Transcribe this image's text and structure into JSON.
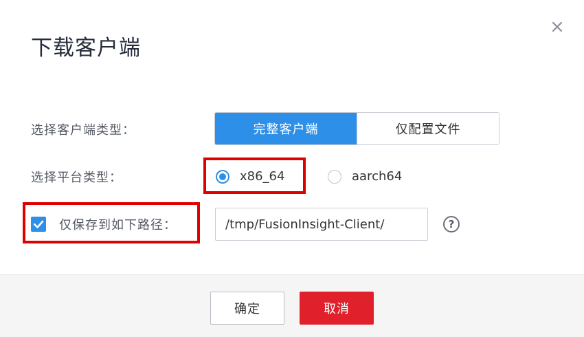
{
  "dialog": {
    "title": "下载客户端",
    "close_icon": "close-icon"
  },
  "client_type": {
    "label": "选择客户端类型：",
    "options": [
      "完整客户端",
      "仅配置文件"
    ],
    "selected": "完整客户端"
  },
  "platform": {
    "label": "选择平台类型：",
    "options": [
      "x86_64",
      "aarch64"
    ],
    "selected": "x86_64"
  },
  "save_path": {
    "checkbox_label": "仅保存到如下路径：",
    "checked": true,
    "value": "/tmp/FusionInsight-Client/",
    "help_icon": "help-circle-icon",
    "help_glyph": "?"
  },
  "footer": {
    "ok_label": "确定",
    "cancel_label": "取消"
  },
  "colors": {
    "accent": "#2d8fe8",
    "danger": "#e0202a",
    "highlight": "#e10000"
  }
}
